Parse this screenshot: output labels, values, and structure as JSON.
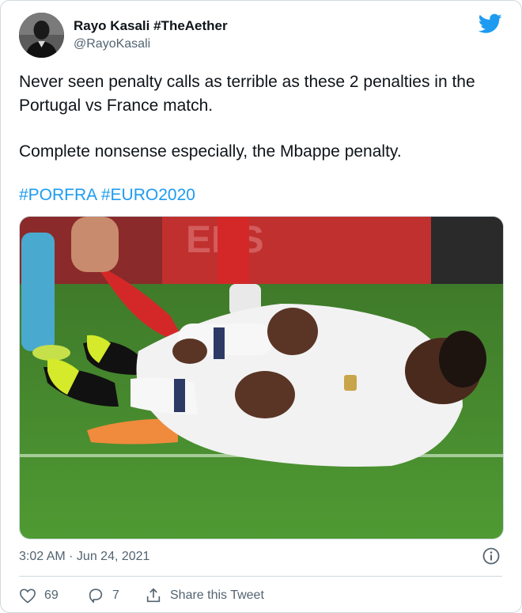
{
  "tweet": {
    "author_name": "Rayo Kasali #TheAether",
    "author_handle": "@RayoKasali",
    "text_paragraph_1": "Never seen penalty calls as terrible as these 2 penalties in the Portugal vs France match.",
    "text_paragraph_2": "Complete nonsense especially, the Mbappe penalty.",
    "hashtags": [
      "#PORFRA",
      "#EURO2020"
    ],
    "timestamp": "3:02 AM · Jun 24, 2021",
    "media_description": "Photo of a French player in a white kit lying on the grass in pain after a tackle"
  },
  "actions": {
    "like_count": "69",
    "reply_count": "7",
    "share_label": "Share this Tweet"
  },
  "icons": {
    "brand": "twitter-bird-icon",
    "info": "info-icon",
    "like": "heart-icon",
    "reply": "reply-bubble-icon",
    "share": "share-icon"
  },
  "colors": {
    "brand": "#1d9bf0",
    "text": "#0f1419",
    "secondary_text": "#536471",
    "border": "#cfd9de"
  }
}
